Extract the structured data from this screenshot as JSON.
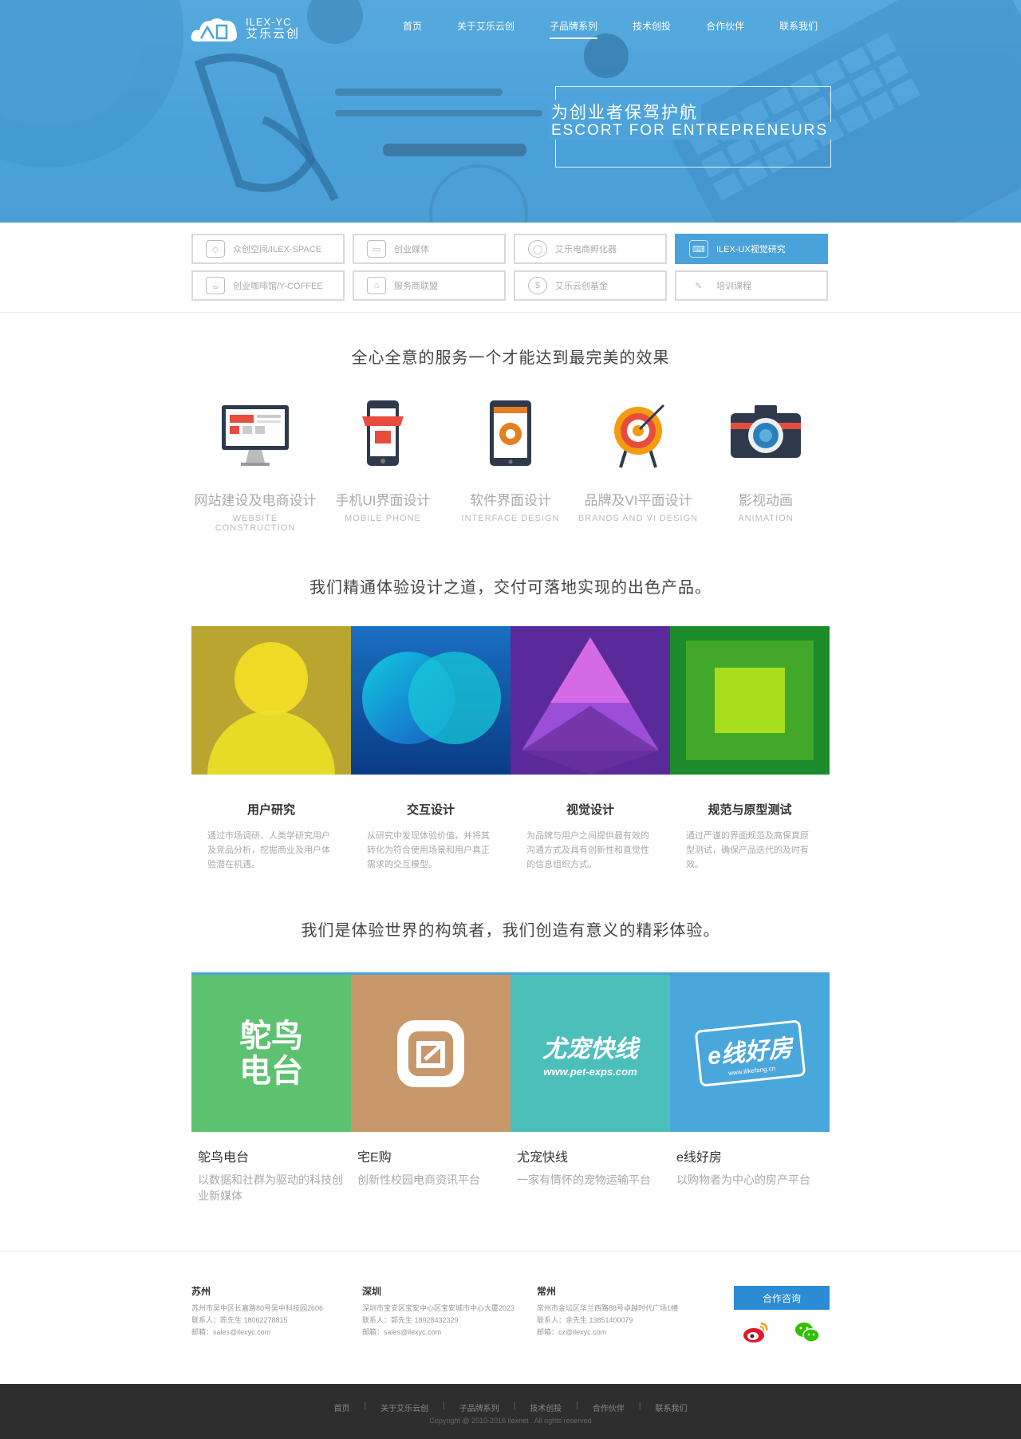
{
  "brand": {
    "name_en": "ILEX-YC",
    "name_cn": "艾乐云创"
  },
  "nav": {
    "items": [
      "首页",
      "关于艾乐云创",
      "子品牌系列",
      "技术创投",
      "合作伙伴",
      "联系我们"
    ],
    "active": "子品牌系列"
  },
  "hero": {
    "slogan_cn": "为创业者保驾护航",
    "slogan_en": "ESCORT FOR ENTREPRENEURS"
  },
  "categories": [
    {
      "label": "众创空间/ILEX-SPACE",
      "icon": "cube-icon",
      "active": false
    },
    {
      "label": "创业媒体",
      "icon": "tv-icon",
      "active": false
    },
    {
      "label": "艾乐电商孵化器",
      "icon": "user-icon",
      "active": false
    },
    {
      "label": "ILEX-UX视觉研究",
      "icon": "keyboard-icon",
      "active": true
    },
    {
      "label": "创业咖啡馆/Y-COFFEE",
      "icon": "coffee-icon",
      "active": false
    },
    {
      "label": "服务商联盟",
      "icon": "store-icon",
      "active": false
    },
    {
      "label": "艾乐云创基金",
      "icon": "dollar-icon",
      "active": false
    },
    {
      "label": "培训课程",
      "icon": "pencil-icon",
      "active": false
    }
  ],
  "services_title": "全心全意的服务一个才能达到最完美的效果",
  "services": [
    {
      "cn": "网站建设及电商设计",
      "en": "WEBSITE CONSTRUCTION"
    },
    {
      "cn": "手机UI界面设计",
      "en": "MOBILE PHONE"
    },
    {
      "cn": "软件界面设计",
      "en": "INTERFACE DESIGN"
    },
    {
      "cn": "品牌及VI平面设计",
      "en": "BRANDS AND VI DESIGN"
    },
    {
      "cn": "影视动画",
      "en": "ANIMATION"
    }
  ],
  "ux_title": "我们精通体验设计之道，交付可落地实现的出色产品。",
  "ux": [
    {
      "title": "用户研究",
      "desc": "通过市场调研、人类学研究用户及竞品分析，挖掘商业及用户体验潜在机遇。"
    },
    {
      "title": "交互设计",
      "desc": "从研究中发现体验价值，并将其转化为符合使用场景和用户真正需求的交互模型。"
    },
    {
      "title": "视觉设计",
      "desc": "为品牌与用户之间提供最有效的沟通方式及具有创新性和直觉性的信息组织方式。"
    },
    {
      "title": "规范与原型测试",
      "desc": "通过严谨的界面规范及高保真原型测试，确保产品迭代的及时有效。"
    }
  ],
  "projects_title": "我们是体验世界的构筑者，我们创造有意义的精彩体验。",
  "projects": [
    {
      "title": "鸵鸟电台",
      "desc": "以数据和社群为驱动的科技创业新媒体",
      "logo_text": [
        "鸵鸟",
        "电台"
      ],
      "color": "#5dc26f"
    },
    {
      "title": "宅E购",
      "desc": "创新性校园电商资讯平台",
      "color": "#c8976a"
    },
    {
      "title": "尤宠快线",
      "desc": "一家有情怀的宠物运输平台",
      "logo_text": [
        "尤宠快线",
        "www.pet-exps.com"
      ],
      "color": "#4dbfbb"
    },
    {
      "title": "e线好房",
      "desc": "以购物者为中心的房产平台",
      "logo_text": [
        "e线好房",
        "www.ilikefang.cn"
      ],
      "color": "#4aa7dc"
    }
  ],
  "contacts": [
    {
      "city": "苏州",
      "address": "苏州市吴中区长嘉路80号吴中科技园2606",
      "person": "联系人：陈先生  18062278815",
      "email": "邮箱：sales@ilexyc.com"
    },
    {
      "city": "深圳",
      "address": "深圳市宝安区宝安中心区宝安城市中心大厦2023",
      "person": "联系人：郭先生  18928432329",
      "email": "邮箱：sales@ilexyc.com"
    },
    {
      "city": "常州",
      "address": "常州市金坛区华兰西路88号卓越时代广场1幢",
      "person": "联系人：余先生  13851400079",
      "email": "邮箱：cz@ilexyc.com"
    }
  ],
  "consult_label": "合作咨询",
  "social": [
    "weibo-icon",
    "wechat-icon"
  ],
  "footer": {
    "nav": [
      "首页",
      "关于艾乐云创",
      "子品牌系列",
      "技术创投",
      "合作伙伴",
      "联系我们"
    ],
    "copyright": "Copyright @ 2010-2016 ilexnet . All rights reserved"
  },
  "colors": {
    "primary": "#4aa2da",
    "dark": "#2e2e2e",
    "button": "#2b8bd3"
  }
}
